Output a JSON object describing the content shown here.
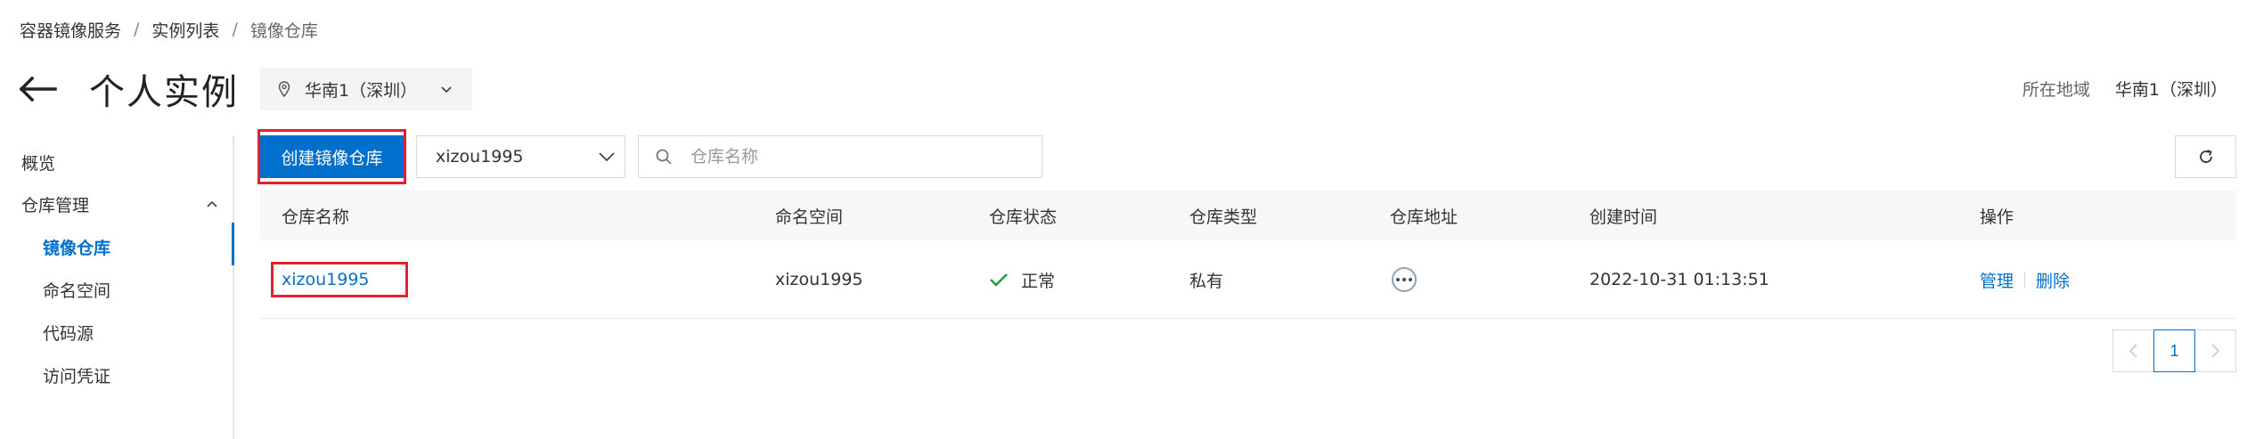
{
  "breadcrumb": {
    "items": [
      "容器镜像服务",
      "实例列表",
      "镜像仓库"
    ],
    "separator": "/"
  },
  "header": {
    "title": "个人实例",
    "region_selector_value": "华南1（深圳）",
    "region_label": "所在地域",
    "region_value": "华南1（深圳）"
  },
  "sidebar": {
    "overview": "概览",
    "group_label": "仓库管理",
    "sub_items": [
      {
        "label": "镜像仓库",
        "active": true
      },
      {
        "label": "命名空间",
        "active": false
      },
      {
        "label": "代码源",
        "active": false
      },
      {
        "label": "访问凭证",
        "active": false
      }
    ]
  },
  "toolbar": {
    "create_label": "创建镜像仓库",
    "namespace_value": "xizou1995",
    "search_placeholder": "仓库名称"
  },
  "table": {
    "columns": [
      "仓库名称",
      "命名空间",
      "仓库状态",
      "仓库类型",
      "仓库地址",
      "创建时间",
      "操作"
    ],
    "rows": [
      {
        "name": "xizou1995",
        "namespace": "xizou1995",
        "status": "正常",
        "type": "私有",
        "created": "2022-10-31 01:13:51",
        "action_manage": "管理",
        "action_delete": "删除"
      }
    ]
  },
  "pagination": {
    "current_page": "1"
  },
  "icons": [
    "back-arrow-icon",
    "location-pin-icon",
    "chevron-down-icon",
    "chevron-up-icon",
    "search-icon",
    "refresh-icon",
    "check-icon",
    "more-dots-icon",
    "chevron-left-icon",
    "chevron-right-icon"
  ],
  "colors": {
    "accent": "#0070cc",
    "highlight_box": "#e0232e",
    "status_ok": "#1ea040"
  }
}
